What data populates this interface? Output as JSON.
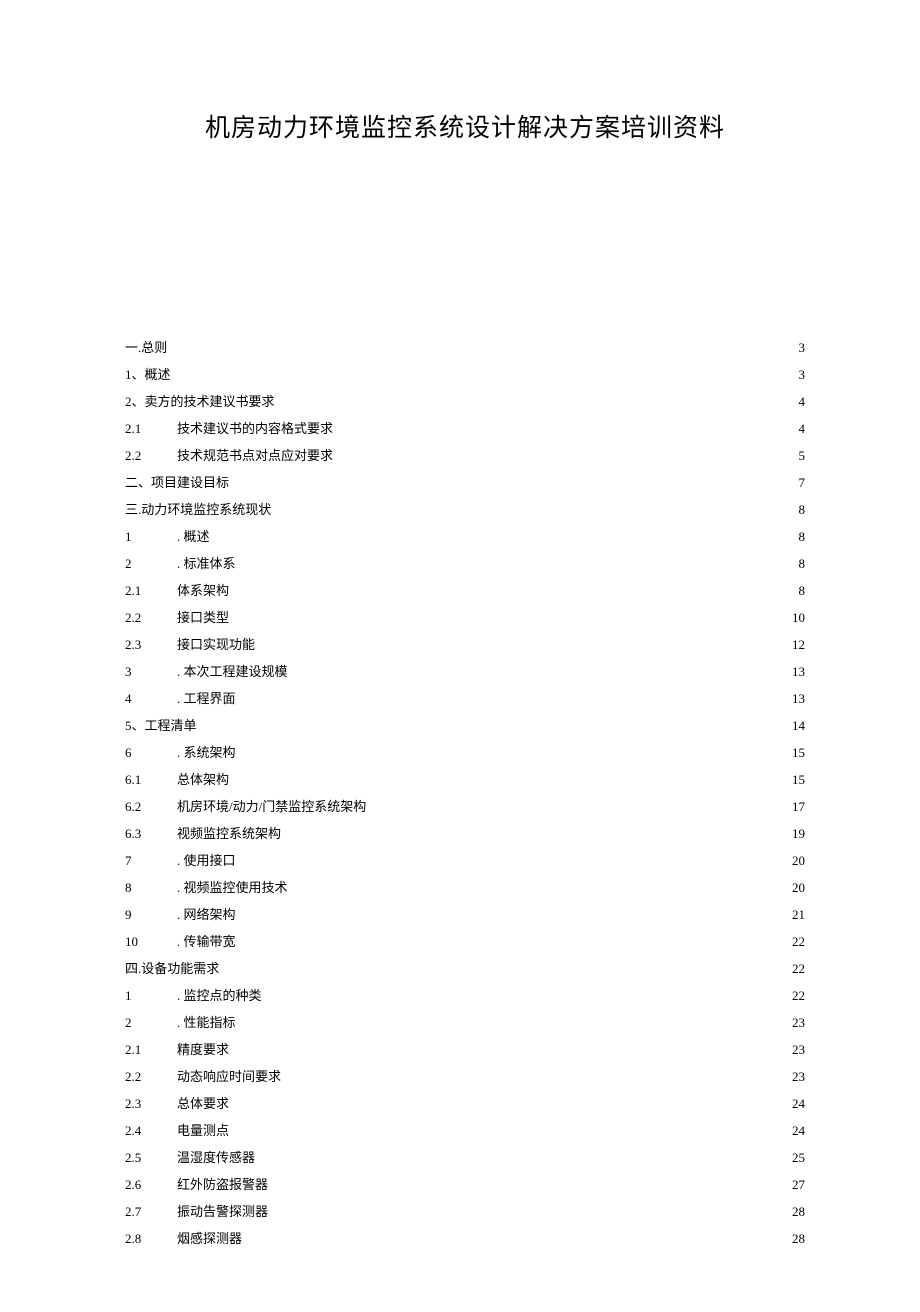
{
  "title": "机房动力环境监控系统设计解决方案培训资料",
  "toc": [
    {
      "num": "一.",
      "sep": "",
      "label": "总则",
      "page": "3",
      "indent": 0
    },
    {
      "num": "1、",
      "sep": "",
      "label": "概述",
      "page": "3",
      "indent": 0
    },
    {
      "num": "2、",
      "sep": "",
      "label": "卖方的技术建议书要求",
      "page": "4",
      "indent": 0
    },
    {
      "num": "2.1",
      "sep": "med",
      "label": "技术建议书的内容格式要求",
      "page": "4",
      "indent": 0
    },
    {
      "num": "2.2",
      "sep": "med",
      "label": "技术规范书点对点应对要求",
      "page": "5",
      "indent": 0
    },
    {
      "num": "二、",
      "sep": "",
      "label": "项目建设目标",
      "page": "7",
      "indent": 0
    },
    {
      "num": "三.",
      "sep": "",
      "label": "动力环境监控系统现状",
      "page": "8",
      "indent": 0
    },
    {
      "num": "1",
      "sep": "med",
      "label": ". 概述",
      "page": "8",
      "indent": 0
    },
    {
      "num": "2",
      "sep": "med",
      "label": ". 标准体系",
      "page": "8",
      "indent": 0
    },
    {
      "num": "2.1",
      "sep": "med",
      "label": "体系架构",
      "page": "8",
      "indent": 0
    },
    {
      "num": "2.2",
      "sep": "med",
      "label": "接口类型",
      "page": "10",
      "indent": 0
    },
    {
      "num": "2.3",
      "sep": "med",
      "label": "接口实现功能",
      "page": "12",
      "indent": 0
    },
    {
      "num": "3",
      "sep": "med",
      "label": ". 本次工程建设规模",
      "page": "13",
      "indent": 0
    },
    {
      "num": "4",
      "sep": "med",
      "label": ". 工程界面",
      "page": "13",
      "indent": 0
    },
    {
      "num": "5、",
      "sep": "",
      "label": "工程清单",
      "page": "14",
      "indent": 0
    },
    {
      "num": "6",
      "sep": "med",
      "label": ". 系统架构",
      "page": "15",
      "indent": 0
    },
    {
      "num": "6.1",
      "sep": "med",
      "label": "总体架构",
      "page": "15",
      "indent": 0
    },
    {
      "num": "6.2",
      "sep": "med",
      "label": "机房环境/动力/门禁监控系统架构",
      "page": "17",
      "indent": 0
    },
    {
      "num": "6.3",
      "sep": "med",
      "label": "视频监控系统架构",
      "page": "19",
      "indent": 0
    },
    {
      "num": "7",
      "sep": "med",
      "label": ". 使用接口",
      "page": "20",
      "indent": 0
    },
    {
      "num": "8",
      "sep": "med",
      "label": ". 视频监控使用技术",
      "page": "20",
      "indent": 0
    },
    {
      "num": "9",
      "sep": "med",
      "label": ". 网络架构",
      "page": "21",
      "indent": 0
    },
    {
      "num": "10",
      "sep": "med",
      "label": ". 传输带宽",
      "page": "22",
      "indent": 0
    },
    {
      "num": "四.",
      "sep": "",
      "label": "设备功能需求",
      "page": "22",
      "indent": 0
    },
    {
      "num": "1",
      "sep": "med",
      "label": ". 监控点的种类",
      "page": "22",
      "indent": 0
    },
    {
      "num": "2",
      "sep": "med",
      "label": ". 性能指标",
      "page": "23",
      "indent": 0
    },
    {
      "num": "2.1",
      "sep": "med",
      "label": "精度要求",
      "page": "23",
      "indent": 0
    },
    {
      "num": "2.2",
      "sep": "med",
      "label": "动态响应时间要求",
      "page": "23",
      "indent": 0
    },
    {
      "num": "2.3",
      "sep": "med",
      "label": "总体要求",
      "page": "24",
      "indent": 0
    },
    {
      "num": "2.4",
      "sep": "med",
      "label": "电量测点",
      "page": "24",
      "indent": 0
    },
    {
      "num": "2.5",
      "sep": "med",
      "label": "温湿度传感器",
      "page": "25",
      "indent": 0
    },
    {
      "num": "2.6",
      "sep": "med",
      "label": "红外防盗报警器",
      "page": "27",
      "indent": 0
    },
    {
      "num": "2.7",
      "sep": "med",
      "label": "振动告警探测器",
      "page": "28",
      "indent": 0
    },
    {
      "num": "2.8",
      "sep": "med",
      "label": "烟感探测器",
      "page": "28",
      "indent": 0
    }
  ]
}
